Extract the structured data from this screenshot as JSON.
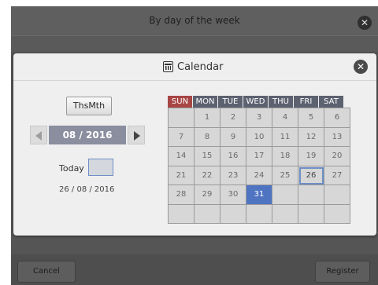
{
  "background": {
    "title": "By day of the week",
    "cancel_label": "Cancel",
    "register_label": "Register",
    "close_glyph": "✕"
  },
  "dialog": {
    "title": "Calendar",
    "close_glyph": "✕",
    "this_month_label": "ThsMth",
    "month_value": "08 / 2016",
    "today_label": "Today",
    "selected_date": "26 / 08 / 2016"
  },
  "calendar": {
    "weekdays": [
      "SUN",
      "MON",
      "TUE",
      "WED",
      "THU",
      "FRI",
      "SAT"
    ],
    "weeks": [
      [
        "",
        "1",
        "2",
        "3",
        "4",
        "5",
        "6"
      ],
      [
        "7",
        "8",
        "9",
        "10",
        "11",
        "12",
        "13"
      ],
      [
        "14",
        "15",
        "16",
        "17",
        "18",
        "19",
        "20"
      ],
      [
        "21",
        "22",
        "23",
        "24",
        "25",
        "26",
        "27"
      ],
      [
        "28",
        "29",
        "30",
        "31",
        "",
        "",
        ""
      ],
      [
        "",
        "",
        "",
        "",
        "",
        "",
        ""
      ]
    ],
    "today_day": "26",
    "selected_day": "31"
  },
  "colors": {
    "accent_blue": "#4f74c2",
    "sunday_red": "#a84646",
    "header_slate": "#5d6271"
  }
}
